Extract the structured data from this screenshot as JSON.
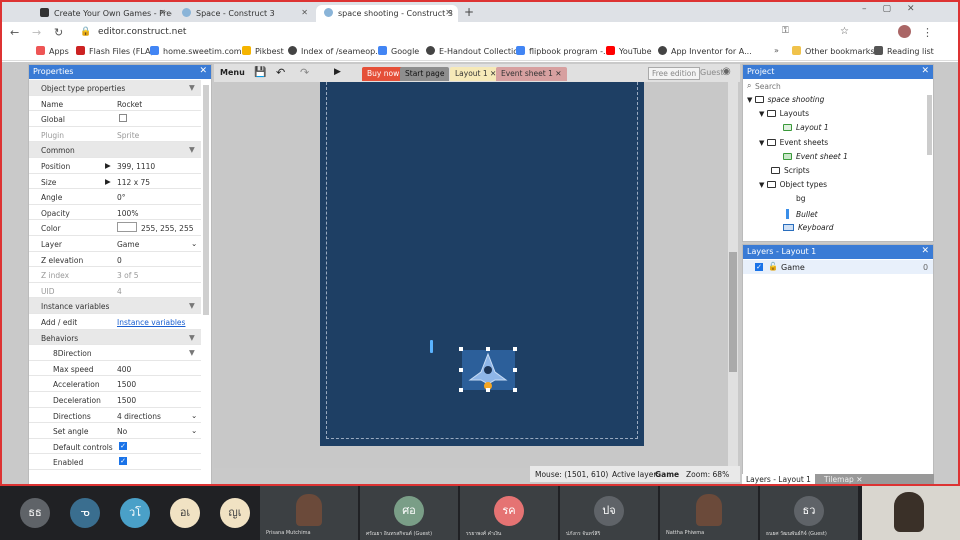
{
  "browser": {
    "tabs": [
      {
        "title": "Create Your Own Games - Free T",
        "active": false
      },
      {
        "title": "Space - Construct 3",
        "active": false
      },
      {
        "title": "space shooting - Construct 3",
        "active": true
      }
    ],
    "url": "editor.construct.net",
    "bookmarks": [
      "Apps",
      "Flash Files (FLA)",
      "home.sweetim.com...",
      "Pikbest",
      "Index of /seameop...",
      "Google",
      "E-Handout Collection",
      "flipbook program -...",
      "YouTube",
      "App Inventor for A..."
    ],
    "other_bookmarks": "Other bookmarks",
    "reading_list": "Reading list"
  },
  "editor": {
    "menu_label": "Menu",
    "tabs": [
      "Buy now",
      "Start page",
      "Layout 1",
      "Event sheet 1"
    ],
    "free_edition": "Free edition",
    "guest": "Guest",
    "status": {
      "mouse": "Mouse: (1501, 610)",
      "active_layer_label": "Active layer:",
      "active_layer": "Game",
      "zoom": "Zoom: 68%"
    }
  },
  "properties": {
    "header": "Properties",
    "rows": [
      {
        "type": "sec",
        "k": "Object type properties"
      },
      {
        "k": "Name",
        "v": "Rocket"
      },
      {
        "k": "Global",
        "check": false
      },
      {
        "k": "Plugin",
        "v": "Sprite",
        "dis": true
      },
      {
        "type": "sec",
        "k": "Common"
      },
      {
        "k": "Position",
        "v": "399, 1110",
        "arrow": true
      },
      {
        "k": "Size",
        "v": "112 x 75",
        "arrow": true
      },
      {
        "k": "Angle",
        "v": "0°"
      },
      {
        "k": "Opacity",
        "v": "100%"
      },
      {
        "k": "Color",
        "v": "255, 255, 255",
        "swatch": true
      },
      {
        "k": "Layer",
        "v": "Game",
        "dd": true
      },
      {
        "k": "Z elevation",
        "v": "0"
      },
      {
        "k": "Z index",
        "v": "3 of 5",
        "dis": true
      },
      {
        "k": "UID",
        "v": "4",
        "dis": true
      },
      {
        "type": "sec",
        "k": "Instance variables"
      },
      {
        "k": "Add / edit",
        "v": "Instance variables",
        "link": true
      },
      {
        "type": "sec",
        "k": "Behaviors"
      },
      {
        "type": "sub",
        "k": "8Direction"
      },
      {
        "k": "Max speed",
        "v": "400",
        "sub": true
      },
      {
        "k": "Acceleration",
        "v": "1500",
        "sub": true
      },
      {
        "k": "Deceleration",
        "v": "1500",
        "sub": true
      },
      {
        "k": "Directions",
        "v": "4 directions",
        "sub": true,
        "dd": true
      },
      {
        "k": "Set angle",
        "v": "No",
        "sub": true,
        "dd": true
      },
      {
        "k": "Default controls",
        "check": true,
        "sub": true
      },
      {
        "k": "Enabled",
        "check": true,
        "sub": true
      }
    ]
  },
  "project": {
    "header": "Project",
    "search_placeholder": "Search",
    "items": [
      {
        "label": "space shooting",
        "level": 0,
        "italic": true
      },
      {
        "label": "Layouts",
        "level": 1
      },
      {
        "label": "Layout 1",
        "level": 2,
        "italic": true
      },
      {
        "label": "Event sheets",
        "level": 1
      },
      {
        "label": "Event sheet 1",
        "level": 2,
        "italic": true
      },
      {
        "label": "Scripts",
        "level": 1
      },
      {
        "label": "Object types",
        "level": 1
      },
      {
        "label": "bg",
        "level": 2
      },
      {
        "label": "Bullet",
        "level": 2,
        "italic": true
      },
      {
        "label": "Keyboard",
        "level": 2,
        "italic": true
      }
    ]
  },
  "layers": {
    "header": "Layers - Layout 1",
    "items": [
      {
        "name": "Game",
        "count": "0"
      }
    ],
    "bottom_tabs": [
      "Layers - Layout 1",
      "Tilemap"
    ]
  },
  "meeting": {
    "participants": [
      {
        "initials": "ธธ",
        "name": "",
        "color": "#5f6368"
      },
      {
        "initials": "ᓀ",
        "name": "",
        "color": "#3a6e8f"
      },
      {
        "initials": "วโ",
        "name": "",
        "color": "#4aa0c8"
      },
      {
        "initials": "อเ",
        "name": "",
        "color": "#f1e2c3"
      },
      {
        "initials": "ญเ",
        "name": "",
        "color": "#f1e2c3"
      },
      {
        "initials": "",
        "name": "Prisana Mutchima",
        "color": ""
      },
      {
        "initials": "ศอ",
        "name": "ศรัณยา อินทรสกิจนต์ (Guest)",
        "color": "#7a9e87"
      },
      {
        "initials": "รค",
        "name": "รรยาพงศ์ คำเงิน",
        "color": "#e57373"
      },
      {
        "initials": "ปจ",
        "name": "ปภังกร จันทร์สิริ",
        "color": "#5f6368"
      },
      {
        "initials": "",
        "name": "Nattha Phiwma",
        "color": ""
      },
      {
        "initials": "ธว",
        "name": "ธนยศ วัฒนพันธ์กิจ์ (Guest)",
        "color": "#5f6368"
      }
    ]
  }
}
